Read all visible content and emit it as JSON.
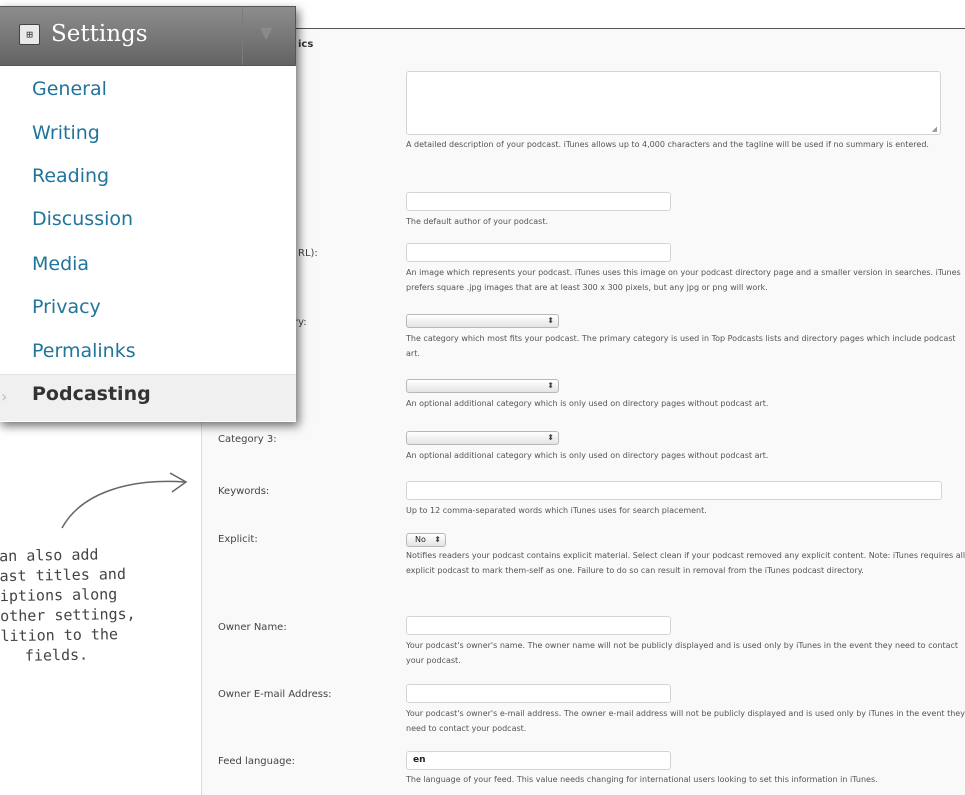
{
  "menu": {
    "title": "Settings",
    "items": [
      "General",
      "Writing",
      "Reading",
      "Discussion",
      "Media",
      "Privacy",
      "Permalinks"
    ],
    "current": "Podcasting"
  },
  "panel": {
    "heading_fragment": "ics",
    "summary_desc": "A detailed description of your podcast. iTunes allows up to 4,000 characters and the tagline will be used if no summary is entered.",
    "author_desc": "The default author of your podcast.",
    "image_label_fragment": "RL):",
    "image_desc": "An image which represents your podcast. iTunes uses this image on your podcast directory page and a smaller version in searches. iTunes prefers square .jpg images that are at least 300 x 300 pixels, but any jpg or png will work.",
    "category_label_fragment": "ry:",
    "category_desc": "The category which most fits your podcast. The primary category is used in Top Podcasts lists and directory pages which include podcast art.",
    "category2_desc": "An optional additional category which is only used on directory pages without podcast art.",
    "category3_label": "Category 3:",
    "category3_desc": "An optional additional category which is only used on directory pages without podcast art.",
    "keywords_label": "Keywords:",
    "keywords_desc": "Up to 12 comma-separated words which iTunes uses for search placement.",
    "explicit_label": "Explicit:",
    "explicit_value": "No",
    "explicit_desc": "Notifies readers your podcast contains explicit material. Select clean if your podcast removed any explicit content. Note: iTunes requires all explicit podcast to mark them-self as one. Failure to do so can result in removal from the iTunes podcast directory.",
    "owner_name_label": "Owner Name:",
    "owner_name_desc": "Your podcast's owner's name. The owner name will not be publicly displayed and is used only by iTunes in the event they need to contact your podcast.",
    "owner_email_label": "Owner E-mail Address:",
    "owner_email_desc": "Your podcast's owner's e-mail address. The owner e-mail address will not be publicly displayed and is used only by iTunes in the event they need to contact your podcast.",
    "language_label": "Feed language:",
    "language_value": "en",
    "language_desc": "The language of your feed. This value needs changing for international users looking to set this information in iTunes."
  },
  "annotation": {
    "lines": [
      "an also add",
      "ast titles and",
      "iptions along",
      "other settings,",
      "lition to the",
      "fields."
    ]
  }
}
